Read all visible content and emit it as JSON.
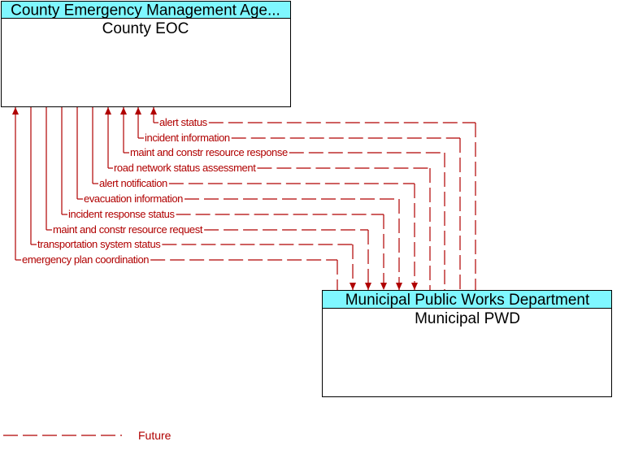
{
  "colors": {
    "header_fill": "#7ff7ff",
    "flow_line": "#b00000",
    "box_border": "#000000"
  },
  "nodes": {
    "county": {
      "title": "County Emergency Management Age...",
      "subtitle": "County EOC"
    },
    "pwd": {
      "title": "Municipal Public Works Department",
      "subtitle": "Municipal PWD"
    }
  },
  "flows": [
    {
      "label": "alert status",
      "direction": "to_county",
      "status": "Future"
    },
    {
      "label": "incident information",
      "direction": "to_county",
      "status": "Future"
    },
    {
      "label": "maint and constr resource response",
      "direction": "to_county",
      "status": "Future"
    },
    {
      "label": "road network status assessment",
      "direction": "to_county",
      "status": "Future"
    },
    {
      "label": "alert notification",
      "direction": "to_pwd",
      "status": "Future"
    },
    {
      "label": "evacuation information",
      "direction": "to_pwd",
      "status": "Future"
    },
    {
      "label": "incident response status",
      "direction": "to_pwd",
      "status": "Future"
    },
    {
      "label": "maint and constr resource request",
      "direction": "to_pwd",
      "status": "Future"
    },
    {
      "label": "transportation system status",
      "direction": "to_pwd",
      "status": "Future"
    },
    {
      "label": "emergency plan coordination",
      "direction": "to_county",
      "status": "Future"
    }
  ],
  "legend": {
    "future_label": "Future"
  }
}
